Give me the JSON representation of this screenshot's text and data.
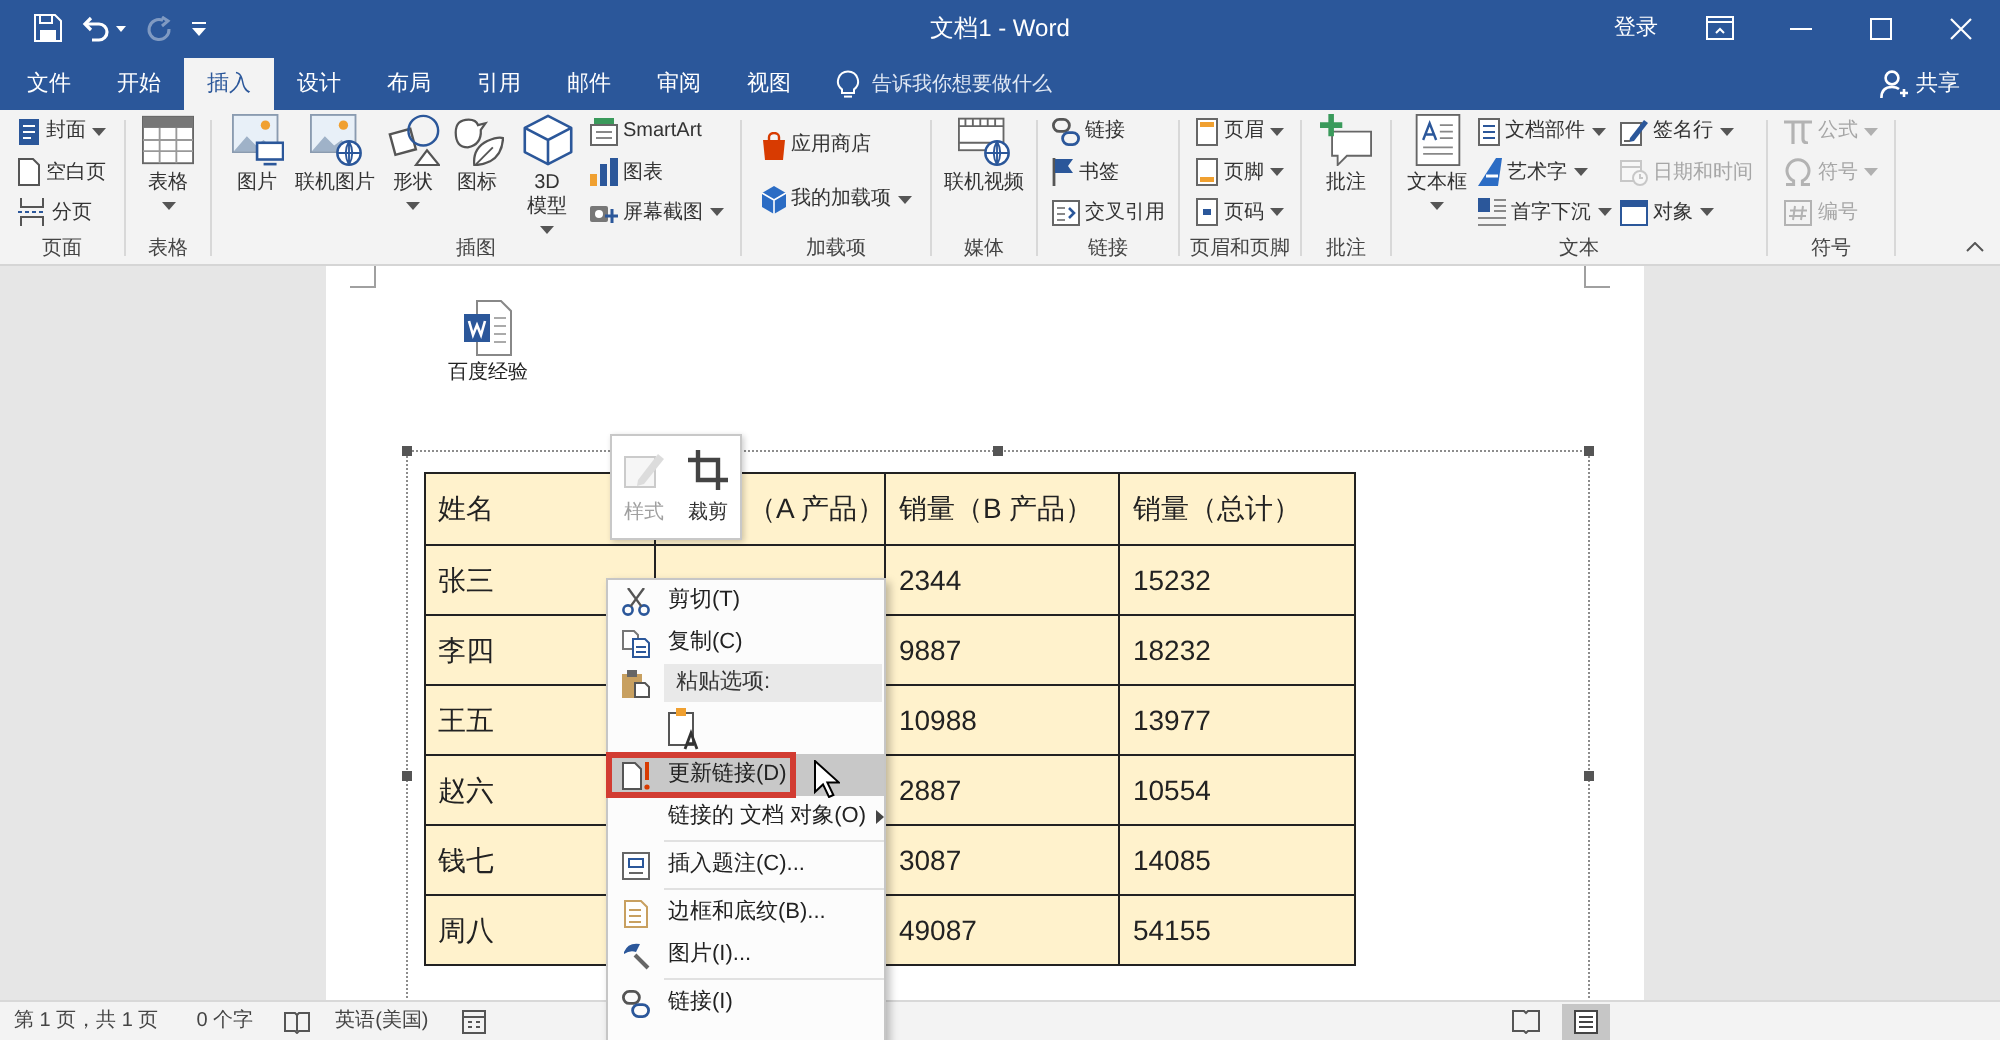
{
  "title_bar": {
    "quick_access": [
      {
        "kind": "save",
        "dropdown": false,
        "disabled": false
      },
      {
        "kind": "undo",
        "dropdown": true,
        "disabled": false
      },
      {
        "kind": "redo",
        "dropdown": false,
        "disabled": true
      },
      {
        "kind": "customize",
        "dropdown": false,
        "disabled": false
      }
    ],
    "title": "文档1 - Word",
    "sign_in": "登录",
    "window_controls": [
      {
        "kind": "ribbon_options"
      },
      {
        "kind": "minimize"
      },
      {
        "kind": "maximize"
      },
      {
        "kind": "close"
      }
    ]
  },
  "tabs": [
    {
      "label": "文件",
      "selected": false
    },
    {
      "label": "开始",
      "selected": false
    },
    {
      "label": "插入",
      "selected": true
    },
    {
      "label": "设计",
      "selected": false
    },
    {
      "label": "布局",
      "selected": false
    },
    {
      "label": "引用",
      "selected": false
    },
    {
      "label": "邮件",
      "selected": false
    },
    {
      "label": "审阅",
      "selected": false
    },
    {
      "label": "视图",
      "selected": false
    }
  ],
  "tell_me": {
    "placeholder": "告诉我你想要做什么"
  },
  "share": {
    "label": "共享"
  },
  "ribbon": {
    "groups": [
      {
        "label": "页面",
        "columns": [
          [
            {
              "kind": "small",
              "label": "封面",
              "dropdown": true,
              "disabled": false
            },
            {
              "kind": "small",
              "label": "空白页",
              "dropdown": false,
              "disabled": false
            },
            {
              "kind": "small",
              "label": "分页",
              "dropdown": false,
              "disabled": false
            }
          ]
        ]
      },
      {
        "label": "表格",
        "columns": [
          [
            {
              "kind": "large",
              "label": "表格",
              "dropdown": true,
              "disabled": false
            }
          ]
        ]
      },
      {
        "label": "插图",
        "columns": [
          [
            {
              "kind": "large",
              "label": "图片",
              "dropdown": false,
              "disabled": false
            }
          ],
          [
            {
              "kind": "large",
              "label": "联机图片",
              "dropdown": false,
              "disabled": false
            }
          ],
          [
            {
              "kind": "large",
              "label": "形状",
              "dropdown": true,
              "disabled": false
            }
          ],
          [
            {
              "kind": "large",
              "label": "图标",
              "dropdown": false,
              "disabled": false
            }
          ],
          [
            {
              "kind": "large",
              "label": "3D 模型",
              "dropdown": true,
              "disabled": false
            }
          ],
          [
            {
              "kind": "small",
              "label": "SmartArt",
              "dropdown": false,
              "disabled": false
            },
            {
              "kind": "small",
              "label": "图表",
              "dropdown": false,
              "disabled": false
            },
            {
              "kind": "small",
              "label": "屏幕截图",
              "dropdown": true,
              "disabled": false
            }
          ]
        ]
      },
      {
        "label": "加载项",
        "columns": [
          [
            {
              "kind": "small",
              "label": "应用商店",
              "dropdown": false,
              "disabled": false
            },
            {
              "kind": "small",
              "label": "我的加载项",
              "dropdown": true,
              "disabled": false
            }
          ]
        ]
      },
      {
        "label": "媒体",
        "columns": [
          [
            {
              "kind": "large",
              "label": "联机视频",
              "dropdown": false,
              "disabled": false
            }
          ]
        ]
      },
      {
        "label": "链接",
        "columns": [
          [
            {
              "kind": "small",
              "label": "链接",
              "dropdown": false,
              "disabled": false
            },
            {
              "kind": "small",
              "label": "书签",
              "dropdown": false,
              "disabled": false
            },
            {
              "kind": "small",
              "label": "交叉引用",
              "dropdown": false,
              "disabled": false
            }
          ]
        ]
      },
      {
        "label": "页眉和页脚",
        "columns": [
          [
            {
              "kind": "small",
              "label": "页眉",
              "dropdown": true,
              "disabled": false
            },
            {
              "kind": "small",
              "label": "页脚",
              "dropdown": true,
              "disabled": false
            },
            {
              "kind": "small",
              "label": "页码",
              "dropdown": true,
              "disabled": false
            }
          ]
        ]
      },
      {
        "label": "批注",
        "columns": [
          [
            {
              "kind": "large",
              "label": "批注",
              "dropdown": false,
              "disabled": false
            }
          ]
        ]
      },
      {
        "label": "文本",
        "columns": [
          [
            {
              "kind": "large",
              "label": "文本框",
              "dropdown": true,
              "disabled": false
            }
          ],
          [
            {
              "kind": "small",
              "label": "文档部件",
              "dropdown": true,
              "disabled": false
            },
            {
              "kind": "small",
              "label": "艺术字",
              "dropdown": true,
              "disabled": false
            },
            {
              "kind": "small",
              "label": "首字下沉",
              "dropdown": true,
              "disabled": false
            }
          ],
          [
            {
              "kind": "small",
              "label": "签名行",
              "dropdown": true,
              "disabled": false
            },
            {
              "kind": "small",
              "label": "日期和时间",
              "dropdown": false,
              "disabled": true
            },
            {
              "kind": "small",
              "label": "对象",
              "dropdown": true,
              "disabled": false
            }
          ]
        ]
      },
      {
        "label": "符号",
        "columns": [
          [
            {
              "kind": "small",
              "label": "公式",
              "dropdown": true,
              "disabled": true
            },
            {
              "kind": "small",
              "label": "符号",
              "dropdown": true,
              "disabled": true
            },
            {
              "kind": "small",
              "label": "编号",
              "dropdown": false,
              "disabled": true
            }
          ]
        ]
      }
    ]
  },
  "document": {
    "embedded_object": {
      "caption": "百度经验"
    },
    "table": {
      "columns": [
        "姓名",
        "（A 产品）",
        "销量（B 产品）",
        "销量（总计）"
      ],
      "rows": [
        {
          "name": "张三",
          "sales_b": "2344",
          "sales_total": "15232"
        },
        {
          "name": "李四",
          "sales_b": "9887",
          "sales_total": "18232"
        },
        {
          "name": "王五",
          "sales_b": "10988",
          "sales_total": "13977"
        },
        {
          "name": "赵六",
          "sales_b": "2887",
          "sales_total": "10554"
        },
        {
          "name": "钱七",
          "sales_b": "3087",
          "sales_total": "14085"
        },
        {
          "name": "周八",
          "sales_b": "49087",
          "sales_total": "54155"
        }
      ]
    }
  },
  "mini_toolbar": {
    "buttons": [
      {
        "label": "样式",
        "disabled": true
      },
      {
        "label": "裁剪",
        "disabled": false
      }
    ]
  },
  "context_menu": {
    "sections": [
      {
        "items": [
          {
            "kind": "command",
            "label": "剪切(T)",
            "selected": false,
            "annotated": false,
            "submenu": false
          },
          {
            "kind": "command",
            "label": "复制(C)",
            "selected": false,
            "annotated": false,
            "submenu": false
          },
          {
            "kind": "header",
            "label": "粘贴选项:",
            "selected": false
          },
          {
            "kind": "paste_option",
            "selected": false
          },
          {
            "kind": "command",
            "label": "更新链接(D)",
            "selected": true,
            "annotated": true,
            "submenu": false
          },
          {
            "kind": "command",
            "label": "链接的 文档 对象(O)",
            "selected": false,
            "annotated": false,
            "submenu": true
          }
        ]
      },
      {
        "items": [
          {
            "kind": "command",
            "label": "插入题注(C)...",
            "selected": false,
            "annotated": false,
            "submenu": false
          }
        ]
      },
      {
        "items": [
          {
            "kind": "command",
            "label": "边框和底纹(B)...",
            "selected": false,
            "annotated": false,
            "submenu": false
          },
          {
            "kind": "command",
            "label": "图片(I)...",
            "selected": false,
            "annotated": false,
            "submenu": false
          }
        ]
      },
      {
        "items": [
          {
            "kind": "command",
            "label": "链接(I)",
            "selected": false,
            "annotated": false,
            "submenu": false
          }
        ]
      }
    ]
  },
  "status_bar": {
    "page": "第 1 页，共 1 页",
    "words": "0 个字",
    "language": "英语(美国)",
    "views": [
      {
        "kind": "read_mode",
        "selected": false
      },
      {
        "kind": "print_layout",
        "selected": true
      }
    ]
  }
}
